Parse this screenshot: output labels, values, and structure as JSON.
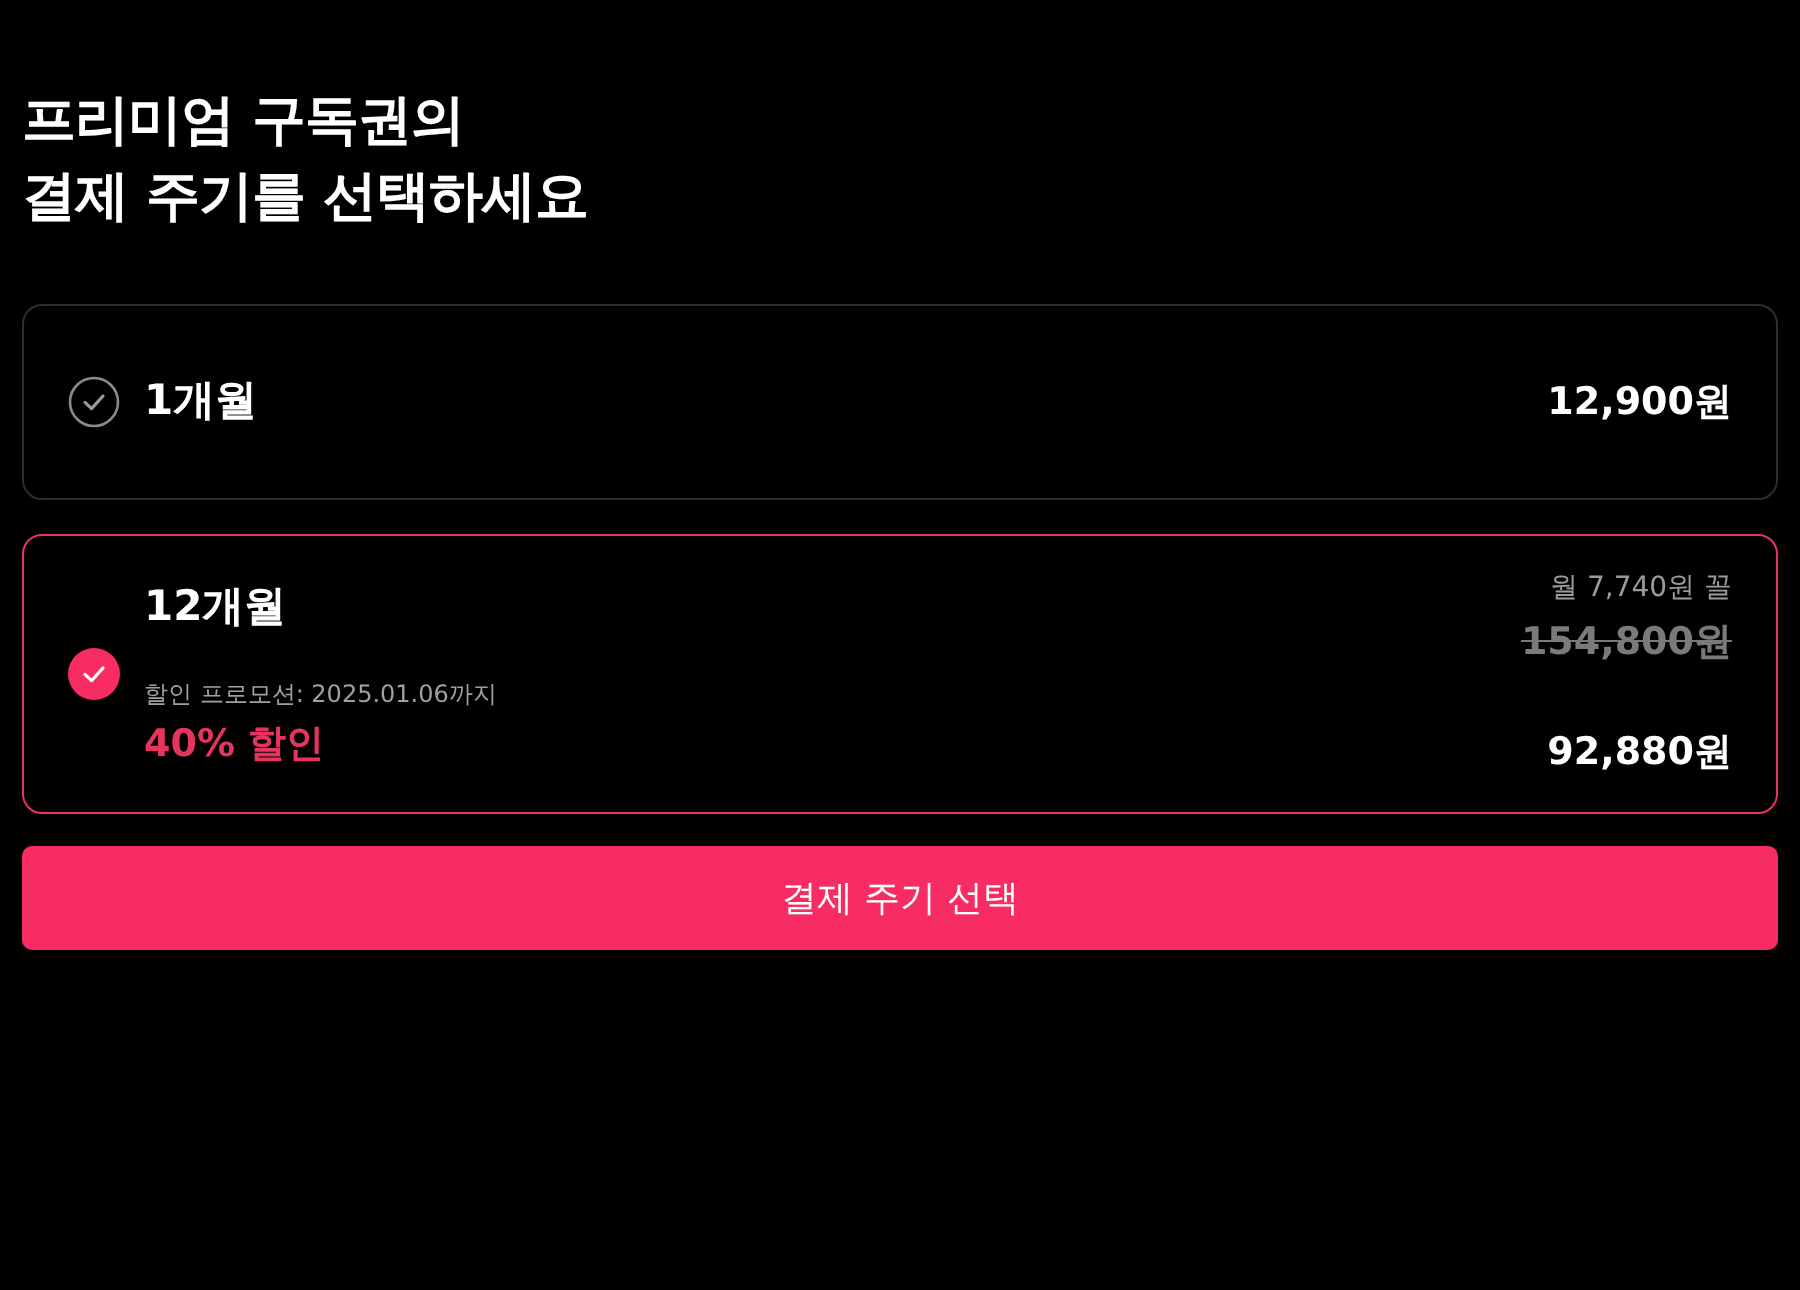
{
  "title_lines": [
    "프리미엄 구독권의",
    "결제 주기를 선택하세요"
  ],
  "plans": [
    {
      "name": "1개월",
      "price": "12,900원",
      "selected": false
    },
    {
      "name": "12개월",
      "price": "92,880원",
      "selected": true,
      "promo": "할인 프로모션: 2025.01.06까지",
      "discount": "40% 할인",
      "monthly": "월 7,740원 꼴",
      "original_price": "154,800원"
    }
  ],
  "button": "결제 주기 선택"
}
